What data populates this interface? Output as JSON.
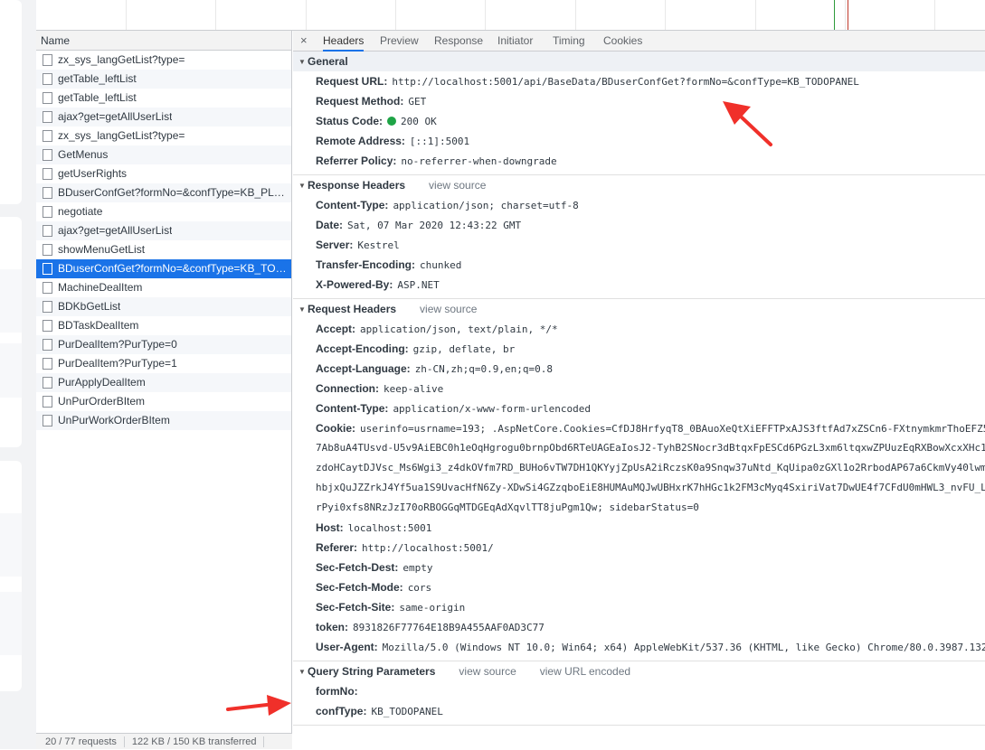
{
  "colors": {
    "accent": "#1a73e8",
    "annotation_arrow": "#f0302a",
    "status_ok": "#1ea446",
    "timeline_green": "#2e9b3b",
    "timeline_red": "#c0392b"
  },
  "request_list": {
    "column_header": "Name",
    "items": [
      "zx_sys_langGetList?type=",
      "getTable_leftList",
      "getTable_leftList",
      "ajax?get=getAllUserList",
      "zx_sys_langGetList?type=",
      "GetMenus",
      "getUserRights",
      "BDuserConfGet?formNo=&confType=KB_PLA...",
      "negotiate",
      "ajax?get=getAllUserList",
      "showMenuGetList",
      "BDuserConfGet?formNo=&confType=KB_TOD...",
      "MachineDealItem",
      "BDKbGetList",
      "BDTaskDealItem",
      "PurDealItem?PurType=0",
      "PurDealItem?PurType=1",
      "PurApplyDealItem",
      "UnPurOrderBItem",
      "UnPurWorkOrderBItem"
    ],
    "selected_index": 11,
    "status": {
      "requests": "20 / 77 requests",
      "transferred": "122 KB / 150 KB transferred"
    }
  },
  "details": {
    "close_glyph": "×",
    "tabs": [
      "Headers",
      "Preview",
      "Response",
      "Initiator",
      "Timing",
      "Cookies"
    ],
    "active_tab": "Headers",
    "general": {
      "title": "General",
      "rows": [
        {
          "k": "Request URL:",
          "v": "http://localhost:5001/api/BaseData/BDuserConfGet?formNo=&confType=KB_TODOPANEL"
        },
        {
          "k": "Request Method:",
          "v": "GET"
        },
        {
          "k": "Status Code:",
          "v": "200 OK"
        },
        {
          "k": "Remote Address:",
          "v": "[::1]:5001"
        },
        {
          "k": "Referrer Policy:",
          "v": "no-referrer-when-downgrade"
        }
      ]
    },
    "response_headers": {
      "title": "Response Headers",
      "view_source": "view source",
      "rows": [
        {
          "k": "Content-Type:",
          "v": "application/json; charset=utf-8"
        },
        {
          "k": "Date:",
          "v": "Sat, 07 Mar 2020 12:43:22 GMT"
        },
        {
          "k": "Server:",
          "v": "Kestrel"
        },
        {
          "k": "Transfer-Encoding:",
          "v": "chunked"
        },
        {
          "k": "X-Powered-By:",
          "v": "ASP.NET"
        }
      ]
    },
    "request_headers": {
      "title": "Request Headers",
      "view_source": "view source",
      "rows_before": [
        {
          "k": "Accept:",
          "v": "application/json, text/plain, */*"
        },
        {
          "k": "Accept-Encoding:",
          "v": "gzip, deflate, br"
        },
        {
          "k": "Accept-Language:",
          "v": "zh-CN,zh;q=0.9,en;q=0.8"
        },
        {
          "k": "Connection:",
          "v": "keep-alive"
        },
        {
          "k": "Content-Type:",
          "v": "application/x-www-form-urlencoded"
        }
      ],
      "cookie": {
        "k": "Cookie:",
        "v": "userinfo=usrname=193; .AspNetCore.Cookies=CfDJ8HrfyqT8_0BAuoXeQtXiEFFTPxAJS3ftfAd7xZSCn6-FXtnymkmrThoEFZ5",
        "continuation": [
          "7Ab8uA4TUsvd-U5v9AiEBC0h1eOqHgrogu0brnpObd6RTeUAGEaIosJ2-TyhB2SNocr3dBtqxFpESCd6PGzL3xm6ltqxwZPUuzEqRXBowXcxXHc1",
          "zdoHCaytDJVsc_Ms6Wgi3_z4dkOVfm7RD_BUHo6vTW7DH1QKYyjZpUsA2iRczsK0a9Snqw37uNtd_KqUipa0zGXl1o2RrbodAP67a6CkmVy40lwm",
          "hbjxQuJZZrkJ4Yf5ua1S9UvacHfN6Zy-XDwSi4GZzqboEiE8HUMAuMQJwUBHxrK7hHGc1k2FM3cMyq4SxiriVat7DwUE4f7CFdU0mHWL3_nvFU_L",
          "rPyi0xfs8NRzJzI70oRBOGGqMTDGEqAdXqvlTT8juPgm1Qw; sidebarStatus=0"
        ]
      },
      "rows_after": [
        {
          "k": "Host:",
          "v": "localhost:5001"
        },
        {
          "k": "Referer:",
          "v": "http://localhost:5001/"
        },
        {
          "k": "Sec-Fetch-Dest:",
          "v": "empty"
        },
        {
          "k": "Sec-Fetch-Mode:",
          "v": "cors"
        },
        {
          "k": "Sec-Fetch-Site:",
          "v": "same-origin"
        },
        {
          "k": "token:",
          "v": "8931826F77764E18B9A455AAF0AD3C77"
        },
        {
          "k": "User-Agent:",
          "v": "Mozilla/5.0 (Windows NT 10.0; Win64; x64) AppleWebKit/537.36 (KHTML, like Gecko) Chrome/80.0.3987.132"
        }
      ]
    },
    "query_string": {
      "title": "Query String Parameters",
      "view_source": "view source",
      "view_url_encoded": "view URL encoded",
      "rows": [
        {
          "k": "formNo:",
          "v": ""
        },
        {
          "k": "confType:",
          "v": "KB_TODOPANEL"
        }
      ]
    }
  }
}
